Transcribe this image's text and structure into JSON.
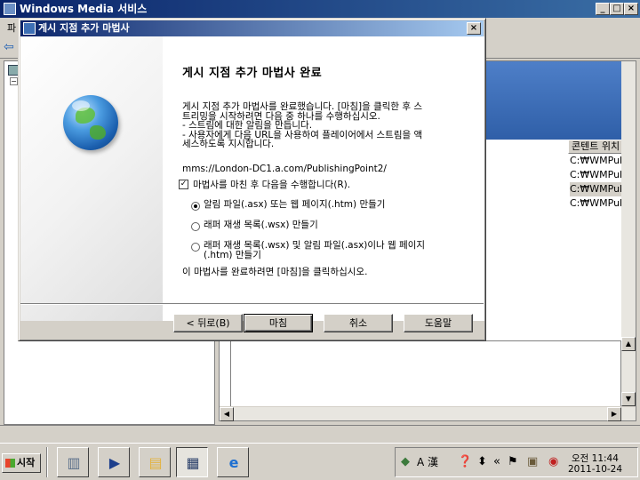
{
  "main_window": {
    "title": "Windows Media 서비스",
    "menu_first": "파",
    "list": {
      "column_header": "콘텐트 위치",
      "rows": [
        "C:₩WMPub",
        "C:₩WMPub",
        "C:₩WMPub",
        "C:₩WMPub"
      ],
      "selected_row": 2
    }
  },
  "dialog": {
    "title": "게시 지점 추가 마법사",
    "heading": "게시 지점 추가 마법사 완료",
    "description_lines": [
      "게시 지점 추가 마법사를 완료했습니다. [마침]을 클릭한 후 스",
      "트리밍을 시작하려면 다음 중 하나를 수행하십시오.",
      "- 스트림에 대한 알림을 만듭니다.",
      "- 사용자에게 다음 URL을 사용하여 플레이어에서 스트림을 액",
      "세스하도록 지시합니다."
    ],
    "url": "mms://London-DC1.a.com/PublishingPoint2/",
    "checkbox_label": "마법사를 마친 후 다음을 수행합니다(R).",
    "checkbox_checked": true,
    "radio_options": [
      {
        "label_lines": [
          "알림 파일(.asx) 또는 웹 페이지(.htm) 만들기"
        ],
        "selected": true
      },
      {
        "label_lines": [
          "래퍼 재생 목록(.wsx) 만들기"
        ],
        "selected": false
      },
      {
        "label_lines": [
          "래퍼 재생 목록(.wsx) 및 알림 파일(.asx)이나 웹 페이지",
          "(.htm) 만들기"
        ],
        "selected": false
      }
    ],
    "finish_hint": "이 마법사를 완료하려면 [마침]을 클릭하십시오.",
    "buttons": {
      "back": "< 뒤로(B)",
      "finish": "마침",
      "cancel": "취소",
      "help": "도움말"
    }
  },
  "taskbar": {
    "start_label": "시작",
    "tray_ime": "A 漢",
    "clock_time": "오전 11:44",
    "clock_date": "2011-10-24"
  }
}
